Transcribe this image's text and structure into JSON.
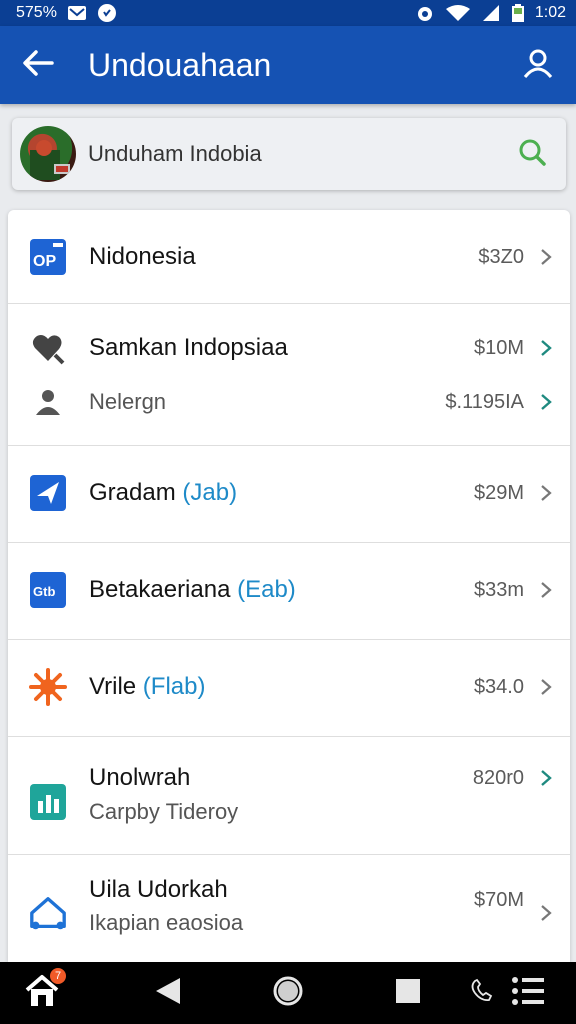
{
  "status_bar": {
    "left_text": "575%",
    "time": "1:02",
    "icons": [
      "mail-icon",
      "notification-icon",
      "alarm-icon",
      "wifi-icon",
      "signal-icon",
      "battery-icon"
    ]
  },
  "app_bar": {
    "title": "Undouahaan",
    "icons": [
      "back-arrow-icon",
      "account-icon"
    ],
    "background": "#1552b3"
  },
  "search": {
    "text": "Unduham Indobia",
    "icon": "search-icon"
  },
  "list": [
    {
      "name": "Nidonesia",
      "tag": "",
      "size": "$3Z0",
      "icon": "app-op-icon",
      "secondary": "",
      "secondary_size": ""
    },
    {
      "name": "Samkan Indopsiaa",
      "tag": "",
      "size": "$10M",
      "icon": "heart-search-icon",
      "secondary": "Nelergn",
      "secondary_size": "$.1195IA"
    },
    {
      "name": "Gradam",
      "tag": "(Jab)",
      "size": "$29M",
      "icon": "send-icon",
      "secondary": "",
      "secondary_size": ""
    },
    {
      "name": "Betakaeriana",
      "tag": "(Eab)",
      "size": "$33m",
      "icon": "gtb-app-icon",
      "secondary": "",
      "secondary_size": ""
    },
    {
      "name": "Vrile",
      "tag": "(Flab)",
      "size": "$34.0",
      "icon": "sun-icon",
      "secondary": "",
      "secondary_size": ""
    },
    {
      "name": "Unolwrah",
      "tag": "",
      "size": "820r0",
      "icon": "chart-app-icon",
      "secondary": "Carpby Tideroy",
      "secondary_size": ""
    },
    {
      "name": "Uila Udorkah",
      "tag": "",
      "size": "$70M",
      "icon": "house-app-icon",
      "secondary": "Ikapian eaosioa",
      "secondary_size": ""
    }
  ],
  "nav_bar": {
    "icons": [
      "home-icon",
      "back-icon",
      "home-circle-icon",
      "recents-icon",
      "phone-icon",
      "menu-icon"
    ],
    "home_badge": "7"
  },
  "colors": {
    "accent": "#1552b3",
    "tag": "#1e8ac8",
    "chevron_teal": "#1f8a80",
    "search_icon": "#4caf50"
  }
}
